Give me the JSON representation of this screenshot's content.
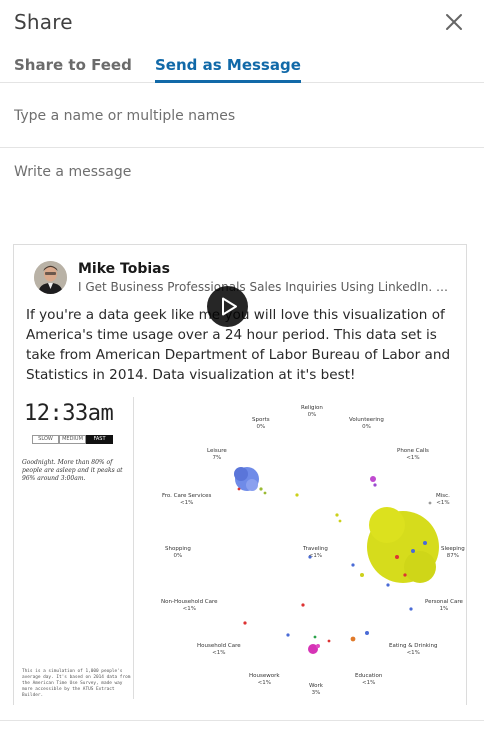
{
  "dialog": {
    "title": "Share",
    "close_icon": "close-icon"
  },
  "tabs": [
    {
      "label": "Share to Feed",
      "active": false
    },
    {
      "label": "Send as Message",
      "active": true
    }
  ],
  "recipients": {
    "placeholder": "Type a name or multiple names",
    "value": ""
  },
  "message": {
    "placeholder": "Write a message",
    "value": ""
  },
  "post": {
    "author": "Mike Tobias",
    "headline": "I Get Business Professionals Sales Inquiries Using LinkedIn. I Also...",
    "text": "If you're a data geek like me you will love this visualization of America's time usage over a 24 hour period. This data set is take from American Department of Labor Bureau of Labor and Statistics in 2014. Data visualization at it's best!",
    "media": {
      "clock": "12:33am",
      "speeds": [
        "SLOW",
        "MEDIUM",
        "FAST"
      ],
      "active_speed": "FAST",
      "blurb": "Goodnight. More than 80% of people are asleep and it peaks at 96% around 3:00am.",
      "footnote": "This is a simulation of 1,000 people's average day. It's based on 2014 data from the American Time Use Survey, made way more accessible by the ATUS Extract Builder.",
      "categories": [
        {
          "name": "Religion",
          "pct": "0%"
        },
        {
          "name": "Sports",
          "pct": "0%"
        },
        {
          "name": "Volunteering",
          "pct": "0%"
        },
        {
          "name": "Leisure",
          "pct": "7%"
        },
        {
          "name": "Phone Calls",
          "pct": "<1%"
        },
        {
          "name": "Fro. Care Services",
          "pct": "<1%"
        },
        {
          "name": "Misc.",
          "pct": "<1%"
        },
        {
          "name": "Shopping",
          "pct": "0%"
        },
        {
          "name": "Traveling",
          "pct": "<1%"
        },
        {
          "name": "Sleeping",
          "pct": "87%"
        },
        {
          "name": "Non-Household Care",
          "pct": "<1%"
        },
        {
          "name": "Personal Care",
          "pct": "1%"
        },
        {
          "name": "Household Care",
          "pct": "<1%"
        },
        {
          "name": "Eating & Drinking",
          "pct": "<1%"
        },
        {
          "name": "Housework",
          "pct": "<1%"
        },
        {
          "name": "Education",
          "pct": "<1%"
        },
        {
          "name": "Work",
          "pct": "3%"
        }
      ],
      "play_icon": "play-icon"
    }
  }
}
